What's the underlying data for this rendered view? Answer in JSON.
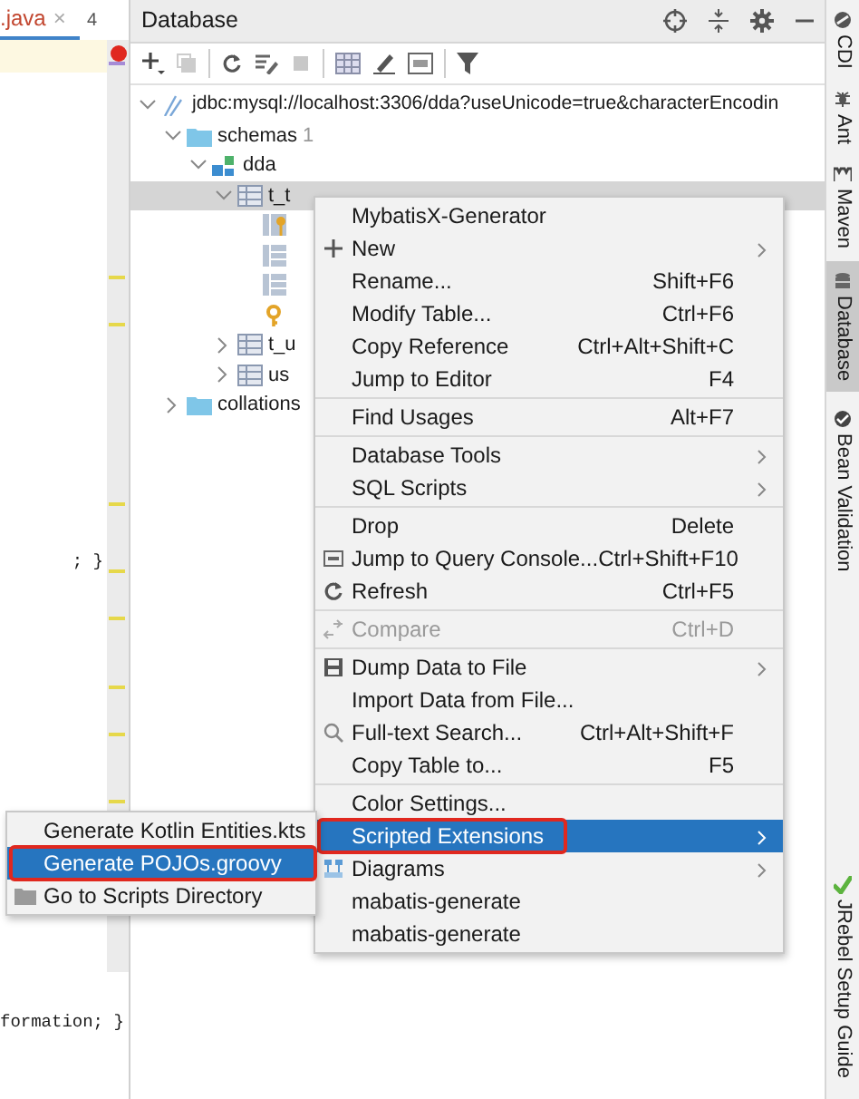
{
  "editor": {
    "tab": {
      "label": ".java",
      "close": "×",
      "count": "4"
    },
    "lines": [
      {
        "text": "; }"
      },
      {
        "text": "formation; }"
      }
    ]
  },
  "panel": {
    "title": "Database",
    "tree": [
      {
        "label": "jdbc:mysql://localhost:3306/dda?useUnicode=true&characterEncodin",
        "kind": "datasource",
        "expanded": true,
        "children": [
          {
            "label": "schemas",
            "count": "1",
            "kind": "folder",
            "expanded": true,
            "children": [
              {
                "label": "dda",
                "kind": "schema",
                "expanded": true,
                "children": [
                  {
                    "label": "t_t",
                    "kind": "table",
                    "expanded": true,
                    "selected": true,
                    "children": [
                      {
                        "kind": "column-key"
                      },
                      {
                        "kind": "column"
                      },
                      {
                        "kind": "column"
                      },
                      {
                        "kind": "key"
                      }
                    ]
                  },
                  {
                    "label": "t_u",
                    "kind": "table",
                    "expanded": false,
                    "selected": false
                  },
                  {
                    "label": "us",
                    "kind": "table",
                    "expanded": false,
                    "selected": false
                  }
                ]
              }
            ]
          },
          {
            "label": "collations",
            "kind": "folder",
            "expanded": false
          }
        ]
      }
    ]
  },
  "menu": [
    {
      "kind": "item",
      "label": "MybatisX-Generator"
    },
    {
      "kind": "item",
      "label": "New",
      "submenu": true
    },
    {
      "kind": "item",
      "label": "Rename...",
      "shortcut": "Shift+F6"
    },
    {
      "kind": "item",
      "label": "Modify Table...",
      "shortcut": "Ctrl+F6"
    },
    {
      "kind": "item",
      "label": "Copy Reference",
      "shortcut": "Ctrl+Alt+Shift+C"
    },
    {
      "kind": "item",
      "label": "Jump to Editor",
      "shortcut": "F4"
    },
    {
      "kind": "separator"
    },
    {
      "kind": "item",
      "label": "Find Usages",
      "shortcut": "Alt+F7"
    },
    {
      "kind": "separator"
    },
    {
      "kind": "item",
      "label": "Database Tools",
      "submenu": true
    },
    {
      "kind": "item",
      "label": "SQL Scripts",
      "submenu": true
    },
    {
      "kind": "separator"
    },
    {
      "kind": "item",
      "label": "Drop",
      "shortcut": "Delete"
    },
    {
      "kind": "item",
      "label": "Jump to Query Console...",
      "shortcut": "Ctrl+Shift+F10"
    },
    {
      "kind": "item",
      "label": "Refresh",
      "shortcut": "Ctrl+F5"
    },
    {
      "kind": "separator"
    },
    {
      "kind": "item",
      "label": "Compare",
      "shortcut": "Ctrl+D",
      "disabled": true
    },
    {
      "kind": "separator"
    },
    {
      "kind": "item",
      "label": "Dump Data to File",
      "submenu": true
    },
    {
      "kind": "item",
      "label": "Import Data from File..."
    },
    {
      "kind": "item",
      "label": "Full-text Search...",
      "shortcut": "Ctrl+Alt+Shift+F"
    },
    {
      "kind": "item",
      "label": "Copy Table to...",
      "shortcut": "F5"
    },
    {
      "kind": "separator"
    },
    {
      "kind": "item",
      "label": "Color Settings..."
    },
    {
      "kind": "item",
      "label": "Scripted Extensions",
      "submenu": true,
      "selected": true,
      "outlined": true
    },
    {
      "kind": "item",
      "label": "Diagrams",
      "submenu": true
    },
    {
      "kind": "item",
      "label": "mabatis-generate"
    },
    {
      "kind": "item",
      "label": "mabatis-generate"
    }
  ],
  "submenu": [
    {
      "label": "Generate Kotlin Entities.kts",
      "selected": false,
      "outlined": false
    },
    {
      "label": "Generate POJOs.groovy",
      "selected": true,
      "outlined": true
    },
    {
      "label": "Go to Scripts Directory",
      "selected": false,
      "outlined": false
    }
  ],
  "tool_windows": [
    {
      "label": "CDI",
      "selected": false
    },
    {
      "label": "Ant",
      "selected": false
    },
    {
      "label": "Maven",
      "selected": false
    },
    {
      "label": "Database",
      "selected": true
    },
    {
      "label": "Bean Validation",
      "selected": false
    },
    {
      "label": "JRebel Setup Guide",
      "selected": false
    }
  ]
}
